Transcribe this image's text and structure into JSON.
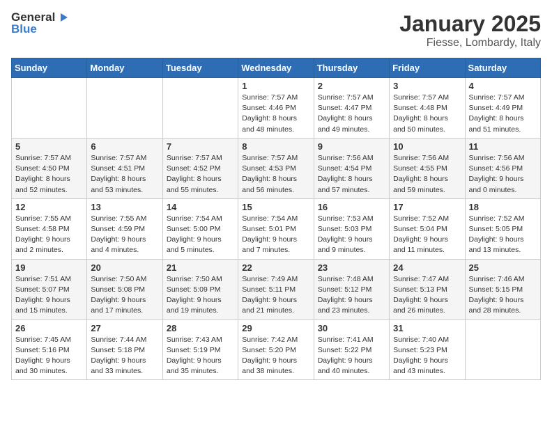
{
  "logo": {
    "general": "General",
    "blue": "Blue"
  },
  "title": "January 2025",
  "location": "Fiesse, Lombardy, Italy",
  "weekdays": [
    "Sunday",
    "Monday",
    "Tuesday",
    "Wednesday",
    "Thursday",
    "Friday",
    "Saturday"
  ],
  "weeks": [
    [
      {
        "day": "",
        "content": ""
      },
      {
        "day": "",
        "content": ""
      },
      {
        "day": "",
        "content": ""
      },
      {
        "day": "1",
        "content": "Sunrise: 7:57 AM\nSunset: 4:46 PM\nDaylight: 8 hours and 48 minutes."
      },
      {
        "day": "2",
        "content": "Sunrise: 7:57 AM\nSunset: 4:47 PM\nDaylight: 8 hours and 49 minutes."
      },
      {
        "day": "3",
        "content": "Sunrise: 7:57 AM\nSunset: 4:48 PM\nDaylight: 8 hours and 50 minutes."
      },
      {
        "day": "4",
        "content": "Sunrise: 7:57 AM\nSunset: 4:49 PM\nDaylight: 8 hours and 51 minutes."
      }
    ],
    [
      {
        "day": "5",
        "content": "Sunrise: 7:57 AM\nSunset: 4:50 PM\nDaylight: 8 hours and 52 minutes."
      },
      {
        "day": "6",
        "content": "Sunrise: 7:57 AM\nSunset: 4:51 PM\nDaylight: 8 hours and 53 minutes."
      },
      {
        "day": "7",
        "content": "Sunrise: 7:57 AM\nSunset: 4:52 PM\nDaylight: 8 hours and 55 minutes."
      },
      {
        "day": "8",
        "content": "Sunrise: 7:57 AM\nSunset: 4:53 PM\nDaylight: 8 hours and 56 minutes."
      },
      {
        "day": "9",
        "content": "Sunrise: 7:56 AM\nSunset: 4:54 PM\nDaylight: 8 hours and 57 minutes."
      },
      {
        "day": "10",
        "content": "Sunrise: 7:56 AM\nSunset: 4:55 PM\nDaylight: 8 hours and 59 minutes."
      },
      {
        "day": "11",
        "content": "Sunrise: 7:56 AM\nSunset: 4:56 PM\nDaylight: 9 hours and 0 minutes."
      }
    ],
    [
      {
        "day": "12",
        "content": "Sunrise: 7:55 AM\nSunset: 4:58 PM\nDaylight: 9 hours and 2 minutes."
      },
      {
        "day": "13",
        "content": "Sunrise: 7:55 AM\nSunset: 4:59 PM\nDaylight: 9 hours and 4 minutes."
      },
      {
        "day": "14",
        "content": "Sunrise: 7:54 AM\nSunset: 5:00 PM\nDaylight: 9 hours and 5 minutes."
      },
      {
        "day": "15",
        "content": "Sunrise: 7:54 AM\nSunset: 5:01 PM\nDaylight: 9 hours and 7 minutes."
      },
      {
        "day": "16",
        "content": "Sunrise: 7:53 AM\nSunset: 5:03 PM\nDaylight: 9 hours and 9 minutes."
      },
      {
        "day": "17",
        "content": "Sunrise: 7:52 AM\nSunset: 5:04 PM\nDaylight: 9 hours and 11 minutes."
      },
      {
        "day": "18",
        "content": "Sunrise: 7:52 AM\nSunset: 5:05 PM\nDaylight: 9 hours and 13 minutes."
      }
    ],
    [
      {
        "day": "19",
        "content": "Sunrise: 7:51 AM\nSunset: 5:07 PM\nDaylight: 9 hours and 15 minutes."
      },
      {
        "day": "20",
        "content": "Sunrise: 7:50 AM\nSunset: 5:08 PM\nDaylight: 9 hours and 17 minutes."
      },
      {
        "day": "21",
        "content": "Sunrise: 7:50 AM\nSunset: 5:09 PM\nDaylight: 9 hours and 19 minutes."
      },
      {
        "day": "22",
        "content": "Sunrise: 7:49 AM\nSunset: 5:11 PM\nDaylight: 9 hours and 21 minutes."
      },
      {
        "day": "23",
        "content": "Sunrise: 7:48 AM\nSunset: 5:12 PM\nDaylight: 9 hours and 23 minutes."
      },
      {
        "day": "24",
        "content": "Sunrise: 7:47 AM\nSunset: 5:13 PM\nDaylight: 9 hours and 26 minutes."
      },
      {
        "day": "25",
        "content": "Sunrise: 7:46 AM\nSunset: 5:15 PM\nDaylight: 9 hours and 28 minutes."
      }
    ],
    [
      {
        "day": "26",
        "content": "Sunrise: 7:45 AM\nSunset: 5:16 PM\nDaylight: 9 hours and 30 minutes."
      },
      {
        "day": "27",
        "content": "Sunrise: 7:44 AM\nSunset: 5:18 PM\nDaylight: 9 hours and 33 minutes."
      },
      {
        "day": "28",
        "content": "Sunrise: 7:43 AM\nSunset: 5:19 PM\nDaylight: 9 hours and 35 minutes."
      },
      {
        "day": "29",
        "content": "Sunrise: 7:42 AM\nSunset: 5:20 PM\nDaylight: 9 hours and 38 minutes."
      },
      {
        "day": "30",
        "content": "Sunrise: 7:41 AM\nSunset: 5:22 PM\nDaylight: 9 hours and 40 minutes."
      },
      {
        "day": "31",
        "content": "Sunrise: 7:40 AM\nSunset: 5:23 PM\nDaylight: 9 hours and 43 minutes."
      },
      {
        "day": "",
        "content": ""
      }
    ]
  ]
}
